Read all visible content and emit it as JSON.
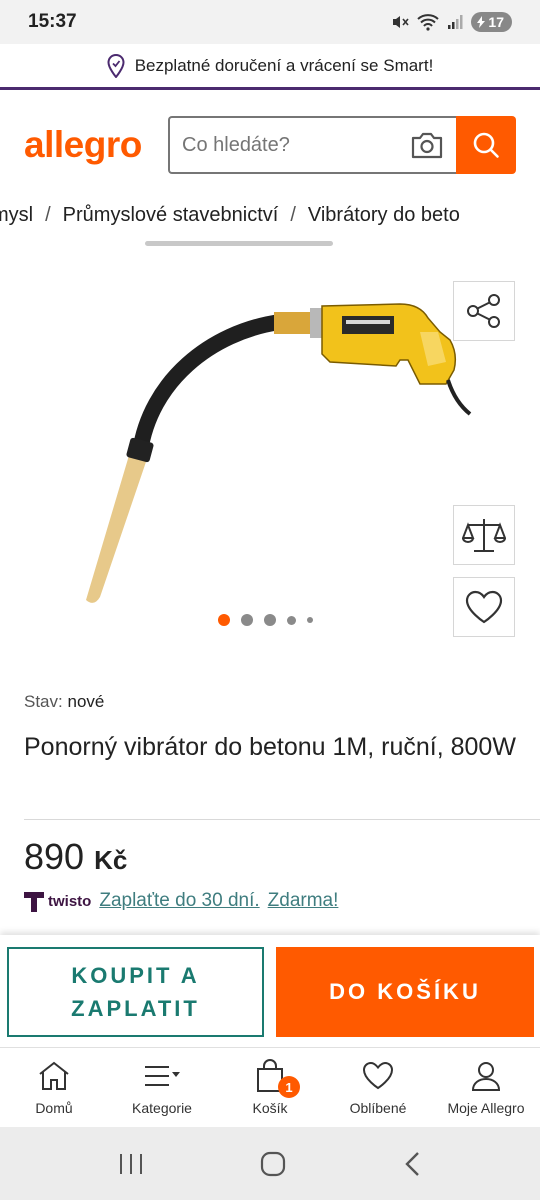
{
  "status_bar": {
    "time": "15:37",
    "battery": "17"
  },
  "promo": {
    "text": "Bezplatné doručení a vrácení se Smart!"
  },
  "header": {
    "logo": "allegro",
    "search_placeholder": "Co hledáte?"
  },
  "breadcrumb": {
    "items": [
      "mysl",
      "Průmyslové stavebnictví",
      "Vibrátory do beto"
    ],
    "separator": "/"
  },
  "gallery": {
    "dots_count": 5,
    "active_dot": 0
  },
  "product": {
    "condition_label": "Stav:",
    "condition_value": "nové",
    "title": "Ponorný vibrátor do betonu 1M, ruční, 800W",
    "price_value": "890",
    "price_currency": "Kč"
  },
  "twisto": {
    "logo": "twisto",
    "pay_later": "Zaplaťte do 30 dní.",
    "free": "Zdarma!"
  },
  "actions": {
    "buy_now": "KOUPIT A ZAPLATIT",
    "add_to_cart": "DO KOŠÍKU"
  },
  "tabbar": {
    "items": [
      {
        "label": "Domů",
        "icon": "home-icon"
      },
      {
        "label": "Kategorie",
        "icon": "menu-icon"
      },
      {
        "label": "Košík",
        "icon": "cart-icon",
        "badge": "1"
      },
      {
        "label": "Oblíbené",
        "icon": "heart-icon"
      },
      {
        "label": "Moje Allegro",
        "icon": "user-icon"
      }
    ]
  },
  "colors": {
    "brand": "#ff5a00",
    "teal": "#1a7a70",
    "purple": "#4b2a6f"
  }
}
